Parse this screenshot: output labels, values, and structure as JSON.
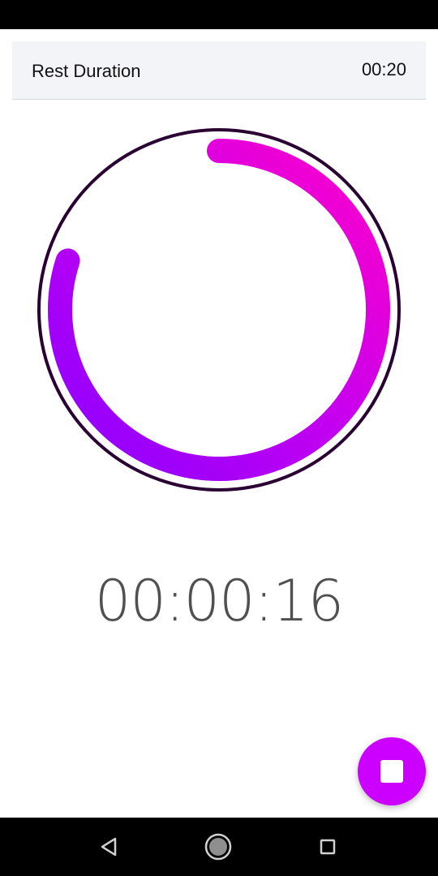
{
  "status_bar": {},
  "rest": {
    "label": "Rest Duration",
    "value": "00:20"
  },
  "timer": {
    "elapsed": "00:00:16",
    "progress_fraction": 0.8,
    "colors": {
      "outer_ring": "#2a0033",
      "gradient_start": "#8a00ff",
      "gradient_mid": "#c400f0",
      "gradient_end": "#ff00c8"
    }
  },
  "fab": {
    "icon": "stop-icon",
    "color": "#cc00ff"
  },
  "nav": {
    "back_icon": "back-triangle-icon",
    "home_icon": "home-circle-icon",
    "recents_icon": "recents-square-icon"
  }
}
